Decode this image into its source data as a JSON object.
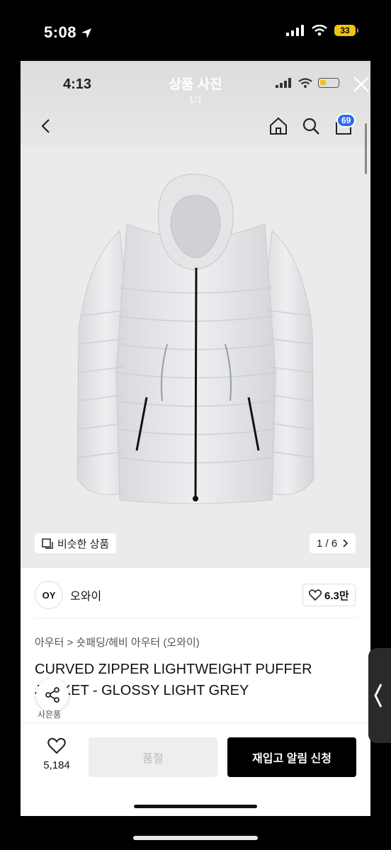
{
  "outer_status": {
    "time": "5:08",
    "battery": "33"
  },
  "viewer": {
    "inner_time": "4:13",
    "title": "상품 사진",
    "count": "1/1"
  },
  "nav": {
    "cart_count": "69"
  },
  "gallery": {
    "similar_label": "비슷한 상품",
    "page_indicator": "1 / 6"
  },
  "brand": {
    "logo": "OY",
    "name": "오와이",
    "likes": "6.3만"
  },
  "product": {
    "breadcrumb": "아우터 > 숏패딩/헤비 아우터 (오와이)",
    "title": "CURVED ZIPPER LIGHTWEIGHT PUFFER JACKET - GLOSSY LIGHT GREY"
  },
  "gift_label": "사은품",
  "bottom": {
    "wish_count": "5,184",
    "soldout_label": "품절",
    "restock_label": "재입고 알림 신청"
  },
  "colors": {
    "accent_badge": "#2d6bf3",
    "cta": "#000000",
    "jacket": "#e3e4e6"
  }
}
